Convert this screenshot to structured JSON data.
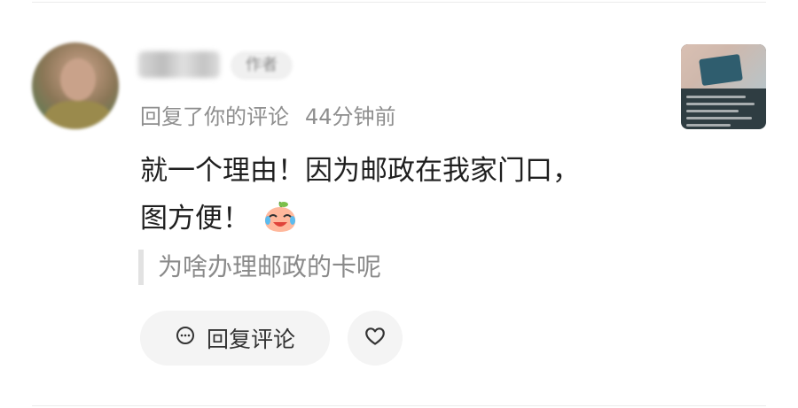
{
  "comment": {
    "username": "",
    "author_badge": "作者",
    "action": "回复了你的评论",
    "time": "44分钟前",
    "text_line1": "就一个理由！因为邮政在我家门口，",
    "text_line2": "图方便！",
    "emoji": "crying-laughing-peach-emoji",
    "quoted_text": "为啥办理邮政的卡呢"
  },
  "actions": {
    "reply_label": "回复评论",
    "reply_icon": "comment-bubble-icon",
    "like_icon": "heart-icon"
  },
  "colors": {
    "primary_text": "#1f1f1f",
    "secondary_text": "#8e8e8e",
    "button_bg": "#f4f4f4"
  }
}
